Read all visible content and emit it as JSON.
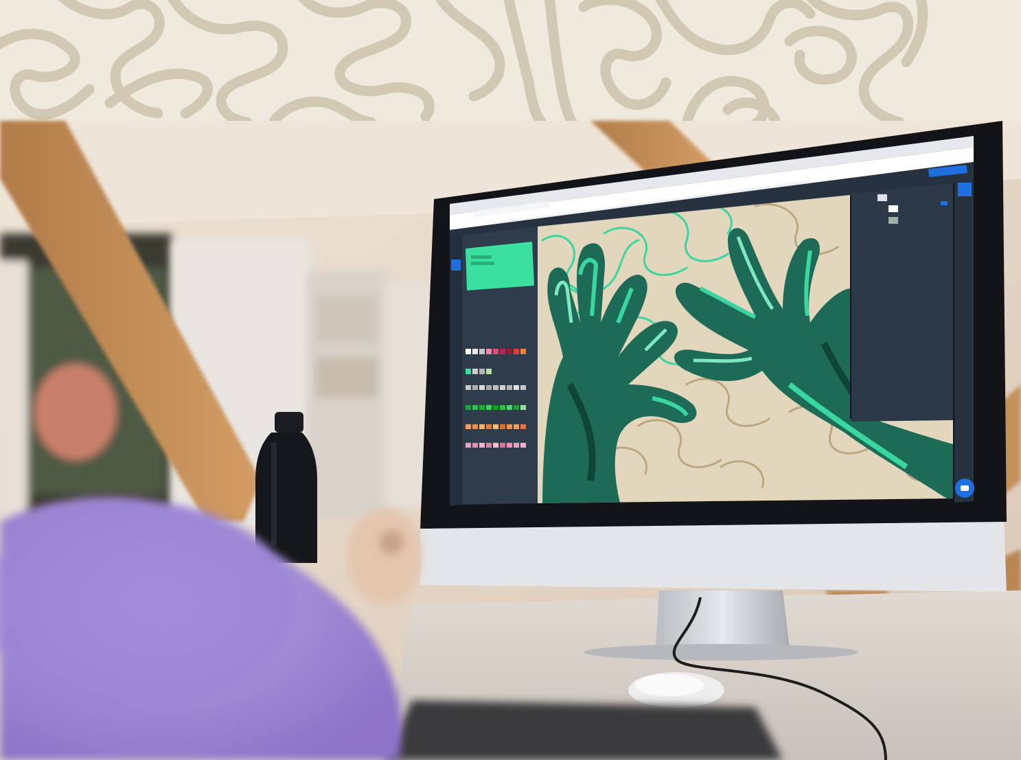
{
  "scene": {
    "description_free": true,
    "header_band_color": "#efe9de",
    "squiggle_color": "#d2c8b3"
  },
  "app": {
    "browser_tab_title": "",
    "document_title": "",
    "primary_action_label": "",
    "layers": [
      {
        "name": ""
      },
      {
        "name": ""
      },
      {
        "name": ""
      }
    ],
    "accent_color": "#3ae0a0",
    "panel_color": "#2e3c4c",
    "brand_blue": "#1f6fe0"
  },
  "icons": [
    "chat-icon",
    "cursor-icon",
    "layers-icon"
  ]
}
